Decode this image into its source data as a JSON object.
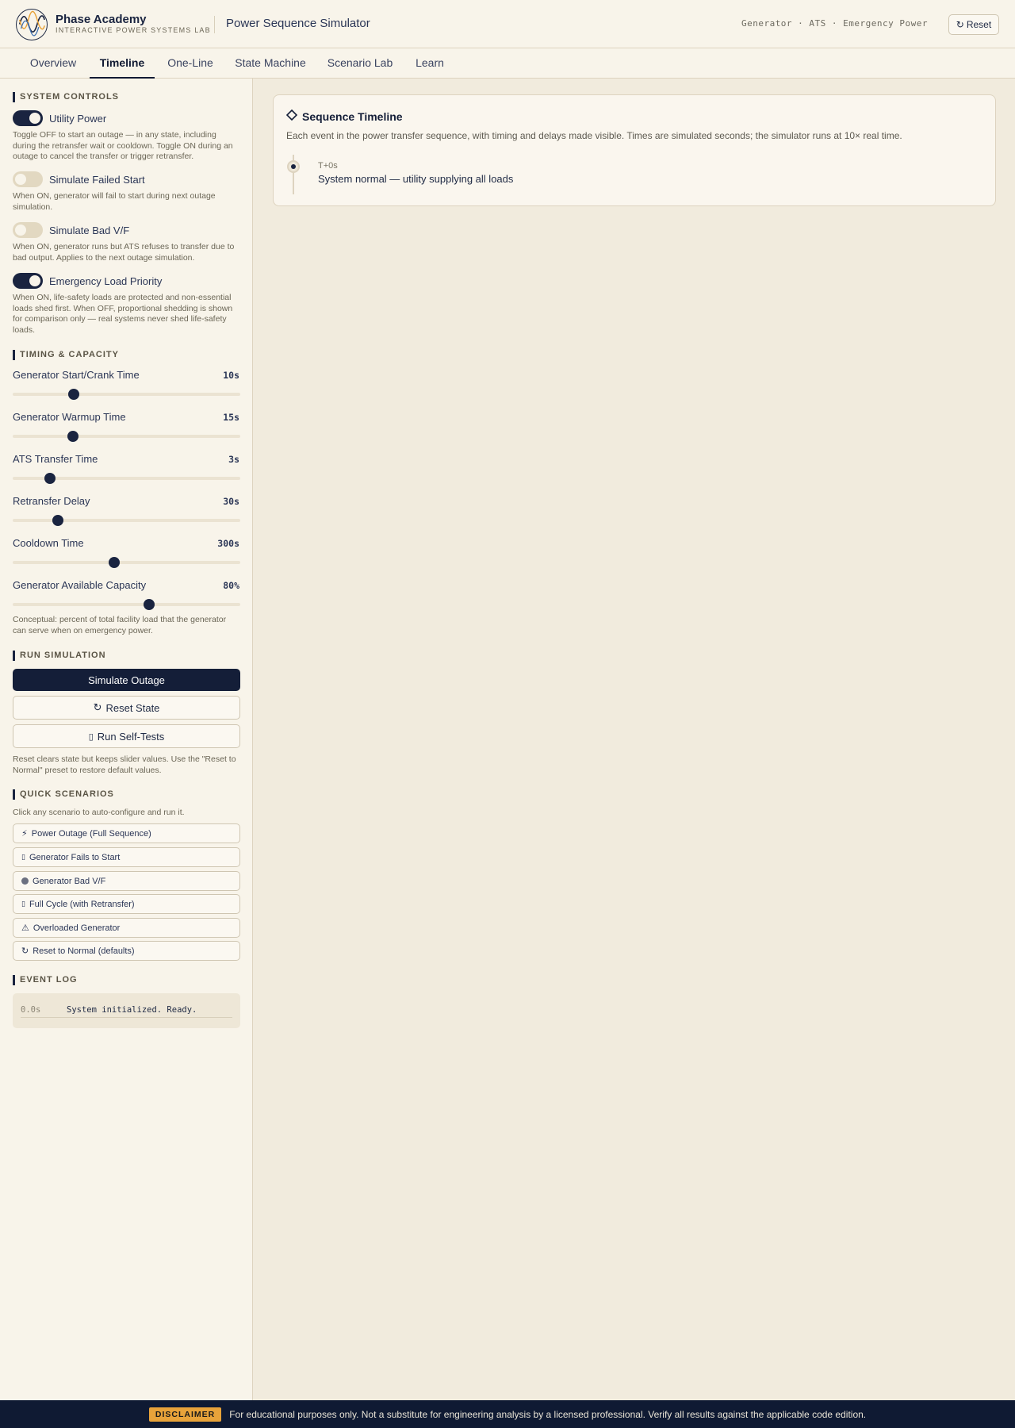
{
  "header": {
    "brand_name": "Phase Academy",
    "brand_sub": "INTERACTIVE POWER SYSTEMS LAB",
    "app_title": "Power Sequence Simulator",
    "tagline": "Generator · ATS · Emergency Power",
    "reset_label": "Reset"
  },
  "tabs": [
    {
      "label": "Overview"
    },
    {
      "label": "Timeline",
      "active": true
    },
    {
      "label": "One-Line"
    },
    {
      "label": "State Machine"
    },
    {
      "label": "Scenario Lab"
    },
    {
      "label": "Learn"
    }
  ],
  "sidebar": {
    "system_controls": {
      "heading": "SYSTEM CONTROLS",
      "toggles": [
        {
          "label": "Utility Power",
          "on": true,
          "help": "Toggle OFF to start an outage — in any state, including during the retransfer wait or cooldown. Toggle ON during an outage to cancel the transfer or trigger retransfer."
        },
        {
          "label": "Simulate Failed Start",
          "on": false,
          "help": "When ON, generator will fail to start during next outage simulation."
        },
        {
          "label": "Simulate Bad V/F",
          "on": false,
          "help": "When ON, generator runs but ATS refuses to transfer due to bad output. Applies to the next outage simulation."
        },
        {
          "label": "Emergency Load Priority",
          "on": true,
          "help": "When ON, life-safety loads are protected and non-essential loads shed first. When OFF, proportional shedding is shown for comparison only — real systems never shed life-safety loads."
        }
      ]
    },
    "timing": {
      "heading": "TIMING & CAPACITY",
      "sliders": [
        {
          "label": "Generator Start/Crank Time",
          "value": "10s",
          "fraction": 0.27
        },
        {
          "label": "Generator Warmup Time",
          "value": "15s",
          "fraction": 0.265
        },
        {
          "label": "ATS Transfer Time",
          "value": "3s",
          "fraction": 0.165
        },
        {
          "label": "Retransfer Delay",
          "value": "30s",
          "fraction": 0.2
        },
        {
          "label": "Cooldown Time",
          "value": "300s",
          "fraction": 0.445
        },
        {
          "label": "Generator Available Capacity",
          "value": "80%",
          "fraction": 0.6
        }
      ],
      "capacity_help": "Conceptual: percent of total facility load that the generator can serve when on emergency power."
    },
    "run": {
      "heading": "RUN SIMULATION",
      "simulate_label": "Simulate Outage",
      "reset_state_label": "Reset State",
      "self_tests_label": "Run Self-Tests",
      "help": "Reset clears state but keeps slider values. Use the \"Reset to Normal\" preset to restore default values."
    },
    "scenarios": {
      "heading": "QUICK SCENARIOS",
      "intro": "Click any scenario to auto-configure and run it.",
      "items": [
        {
          "icon": "⚡",
          "label": "Power Outage (Full Sequence)"
        },
        {
          "icon": "",
          "label": "Generator Fails to Start"
        },
        {
          "icon": "",
          "label": "Generator Bad V/F"
        },
        {
          "icon": "",
          "label": "Full Cycle (with Retransfer)"
        },
        {
          "icon": "⚠",
          "label": "Overloaded Generator"
        },
        {
          "icon": "↻",
          "label": "Reset to Normal (defaults)"
        }
      ]
    },
    "event_log": {
      "heading": "EVENT LOG",
      "entries": [
        {
          "time": "0.0s",
          "message": "System initialized. Ready."
        }
      ]
    }
  },
  "main": {
    "card": {
      "title": "Sequence Timeline",
      "description": "Each event in the power transfer sequence, with timing and delays made visible. Times are simulated seconds; the simulator runs at 10× real time.",
      "events": [
        {
          "time": "T+0s",
          "text": "System normal — utility supplying all loads"
        }
      ]
    }
  },
  "footer": {
    "badge": "DISCLAIMER",
    "text": "For educational purposes only. Not a substitute for engineering analysis by a licensed professional. Verify all results against the applicable code edition."
  },
  "colors": {
    "navy": "#1a2440",
    "cream": "#f8f4ea",
    "amber": "#e8a33a"
  }
}
